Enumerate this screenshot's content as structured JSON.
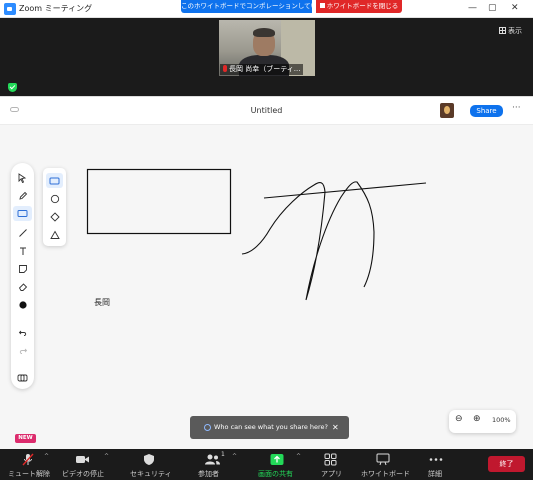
{
  "window": {
    "title": "Zoom ミーティング",
    "controls": [
      "—",
      "▢",
      "✕"
    ]
  },
  "share_banner": {
    "notice": "このホワイトボードでコンポレーションしています",
    "close_label": "ホワイトボードを閉じる"
  },
  "video": {
    "participant_name": "長岡 尚幸（ブーティ...",
    "view_label": "表示"
  },
  "whiteboard": {
    "title": "Untitled",
    "share_label": "Share",
    "more_label": "···",
    "canvas_text": "長岡",
    "tools": [
      "select-icon",
      "pen-icon",
      "shapes-icon",
      "line-icon",
      "text-icon",
      "sticky-note-icon",
      "eraser-icon",
      "color-icon",
      "undo-icon",
      "redo-icon",
      "components-icon"
    ],
    "shapes": [
      "rectangle-icon",
      "circle-icon",
      "diamond-icon",
      "triangle-icon"
    ]
  },
  "toast": {
    "text": "Who can see what you share here?",
    "close": "✕"
  },
  "zoom": {
    "zoom_out": "⊖",
    "zoom_in": "⊕",
    "level": "100%"
  },
  "badge": {
    "new": "NEW"
  },
  "controls": {
    "mute": "ミュート解除",
    "video": "ビデオの停止",
    "security": "セキュリティ",
    "participants": "参加者",
    "participants_count": "1",
    "share": "画面の共有",
    "apps": "アプリ",
    "whiteboard": "ホワイトボード",
    "more": "詳細",
    "end": "終了"
  },
  "colors": {
    "accent_blue": "#0e72ed",
    "close_red": "#e02828",
    "share_green": "#23d959",
    "end_red": "#c0182e"
  }
}
